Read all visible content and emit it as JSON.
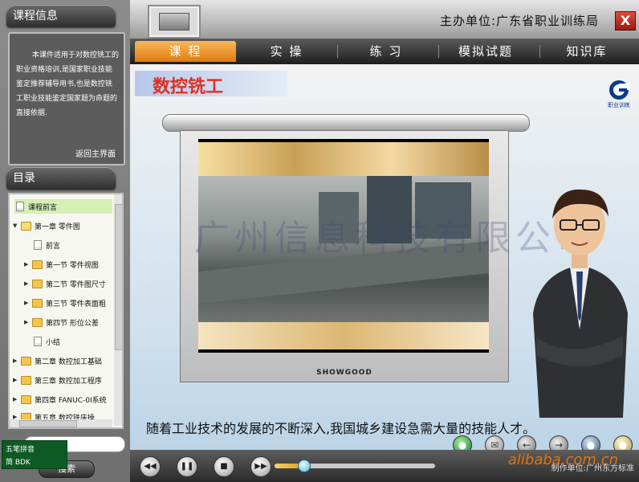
{
  "sidebar": {
    "info_title": "课程信息",
    "info_text": "本课件适用于对数控铣工的职业资格培训,是国家职业技能鉴定推荐辅导用书,也是数控铣工职业技能鉴定国家题为命题的直接依据.",
    "back_label": "返回主界面",
    "toc_title": "目录",
    "toc": [
      {
        "label": "课程前言",
        "icon": "doc-icon"
      },
      {
        "label": "第一章 零件图",
        "icon": "folder-open-icon"
      },
      {
        "label": "前言",
        "icon": "doc-icon"
      },
      {
        "label": "第一节 零件视图",
        "icon": "folder-icon"
      },
      {
        "label": "第二节 零件图尺寸",
        "icon": "folder-icon"
      },
      {
        "label": "第三节 零件表面粗",
        "icon": "folder-icon"
      },
      {
        "label": "第四节 形位公差",
        "icon": "folder-icon"
      },
      {
        "label": "小结",
        "icon": "doc-icon"
      },
      {
        "label": "第二章 数控加工基础",
        "icon": "folder-icon"
      },
      {
        "label": "第三章 数控加工程序",
        "icon": "folder-icon"
      },
      {
        "label": "第四章 FANUC-0I系统",
        "icon": "folder-icon"
      },
      {
        "label": "第五章 数控铣床操",
        "icon": "folder-icon"
      }
    ],
    "search_button": "搜索",
    "ime_line1": "五笔拼音",
    "ime_line2": "简 BDK"
  },
  "header": {
    "organizer": "主办单位:广东省职业训练局",
    "close_label": "X"
  },
  "nav": {
    "tabs": [
      "课 程",
      "实 操",
      "练 习",
      "模拟试题",
      "知识库"
    ],
    "active": 0
  },
  "content": {
    "course_title": "数控铣工",
    "logo_text": "职业训练",
    "projector_brand": "SHOWGOOD",
    "watermark": "广州信息科技有限公司",
    "subtitle": "随着工业技术的发展的不断深入,我国城乡建设急需大量的技能人才。"
  },
  "player": {
    "progress": 0.18,
    "credit": "制作单位:广州东方标准",
    "overlay_watermark": "alibaba.com.cn"
  },
  "colors": {
    "accent_tab": "#e98a1a",
    "title_red": "#e03020",
    "close_red": "#c2281b"
  }
}
